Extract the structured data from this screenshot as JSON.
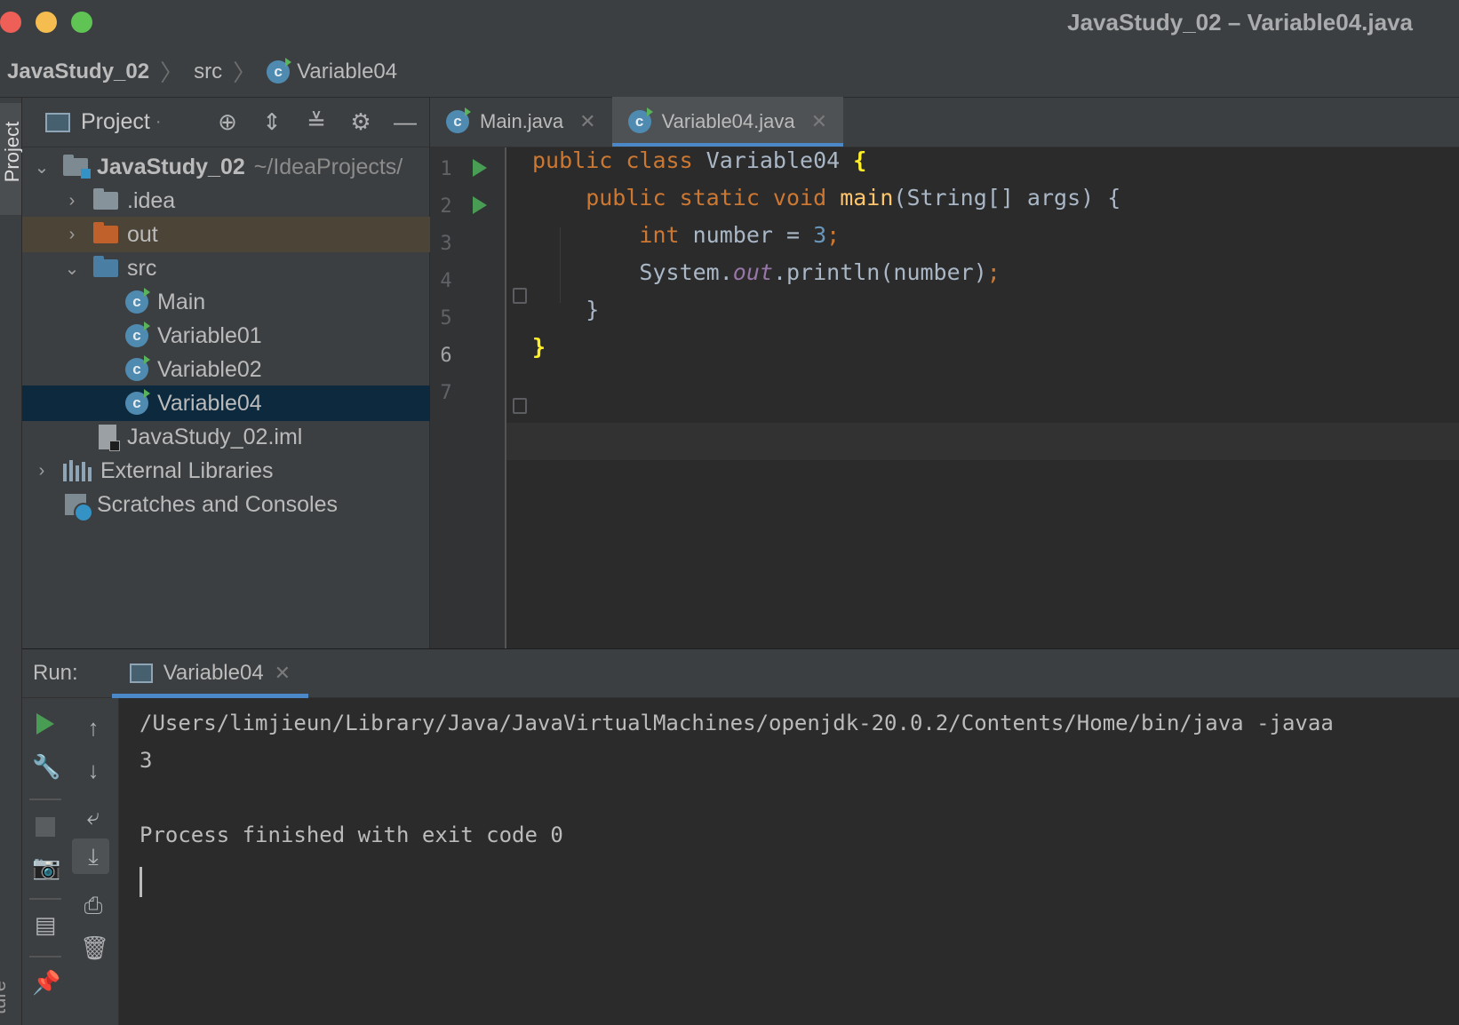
{
  "window": {
    "title": "JavaStudy_02 – Variable04.java"
  },
  "breadcrumb": {
    "project": "JavaStudy_02",
    "folder": "src",
    "file": "Variable04"
  },
  "side_tabs": {
    "project": "Project",
    "structure": "ture"
  },
  "project_panel": {
    "title": "Project",
    "tree": [
      {
        "label": "JavaStudy_02",
        "suffix": "~/IdeaProjects/"
      },
      {
        "label": ".idea"
      },
      {
        "label": "out"
      },
      {
        "label": "src"
      },
      {
        "label": "Main"
      },
      {
        "label": "Variable01"
      },
      {
        "label": "Variable02"
      },
      {
        "label": "Variable04"
      },
      {
        "label": "JavaStudy_02.iml"
      },
      {
        "label": "External Libraries"
      },
      {
        "label": "Scratches and Consoles"
      }
    ]
  },
  "editor": {
    "tabs": [
      {
        "label": "Main.java"
      },
      {
        "label": "Variable04.java"
      }
    ],
    "line_numbers": [
      "1",
      "2",
      "3",
      "4",
      "5",
      "6",
      "7"
    ],
    "code": {
      "l1_kw": "public class ",
      "l1_name": "Variable04 ",
      "l1_brace": "{",
      "l2_kw": "    public static void ",
      "l2_fn": "main",
      "l2_rest": "(String[] args) {",
      "l3_kw": "        int ",
      "l3_rest": "number = ",
      "l3_num": "3",
      "l3_semi": ";",
      "l4_a": "        System.",
      "l4_static": "out",
      "l4_b": ".println(number)",
      "l4_semi": ";",
      "l5": "    }",
      "l6": "}"
    }
  },
  "run_panel": {
    "label": "Run:",
    "tab": "Variable04",
    "console": [
      "/Users/limjieun/Library/Java/JavaVirtualMachines/openjdk-20.0.2/Contents/Home/bin/java -javaa",
      "3",
      "",
      "Process finished with exit code 0"
    ]
  },
  "colors": {
    "keyword": "#cc7832",
    "function": "#ffc66d",
    "number": "#6897bb",
    "static_field": "#9876aa",
    "selection": "#0d293e",
    "accent": "#4a88c7"
  }
}
